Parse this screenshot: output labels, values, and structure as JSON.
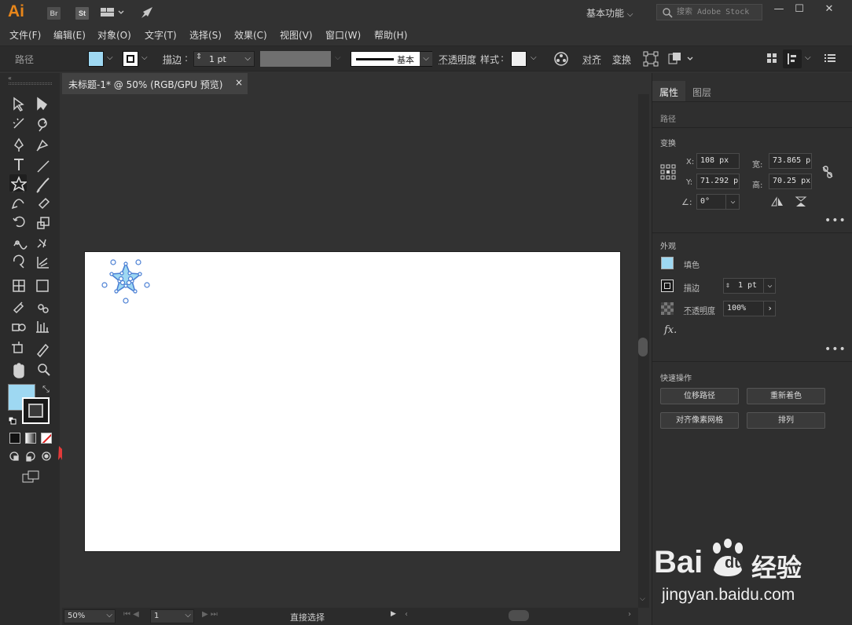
{
  "app": {
    "logo": "Ai",
    "bridge": "Br",
    "stock": "St",
    "workspace": "基本功能",
    "search_placeholder": "搜索 Adobe Stock"
  },
  "menu": [
    "文件(F)",
    "编辑(E)",
    "对象(O)",
    "文字(T)",
    "选择(S)",
    "效果(C)",
    "视图(V)",
    "窗口(W)",
    "帮助(H)"
  ],
  "controlbar": {
    "object_type": "路径",
    "stroke_label": "描边",
    "stroke_value": "1 pt",
    "brush_style": "基本",
    "opacity_label": "不透明度",
    "style_label": "样式",
    "align_label": "对齐",
    "transform_label": "变换",
    "colors": {
      "fill": "#9ed8f2"
    }
  },
  "document": {
    "tab_title": "未标题-1* @ 50% (RGB/GPU 预览)",
    "close": "×"
  },
  "status": {
    "zoom": "50%",
    "page": "1",
    "tool": "直接选择"
  },
  "properties": {
    "tabs": [
      "属性",
      "图层"
    ],
    "object_type": "路径",
    "transform": {
      "title": "变换",
      "x_label": "X:",
      "x_value": "108 px",
      "y_label": "Y:",
      "y_value": "71.292 p",
      "w_label": "宽:",
      "w_value": "73.865 p",
      "h_label": "高:",
      "h_value": "70.25 px",
      "angle_value": "0°"
    },
    "appearance": {
      "title": "外观",
      "fill_label": "填色",
      "stroke_label": "描边",
      "stroke_value": "1 pt",
      "opacity_label": "不透明度",
      "opacity_value": "100%",
      "fx": "fx."
    },
    "quick_actions": {
      "title": "快速操作",
      "offset_path": "位移路径",
      "recolor": "重新着色",
      "align_pixel": "对齐像素网格",
      "arrange": "排列"
    }
  },
  "watermark": {
    "brand": "Bai",
    "brand2": "du",
    "cn": "经验",
    "url": "jingyan.baidu.com"
  }
}
